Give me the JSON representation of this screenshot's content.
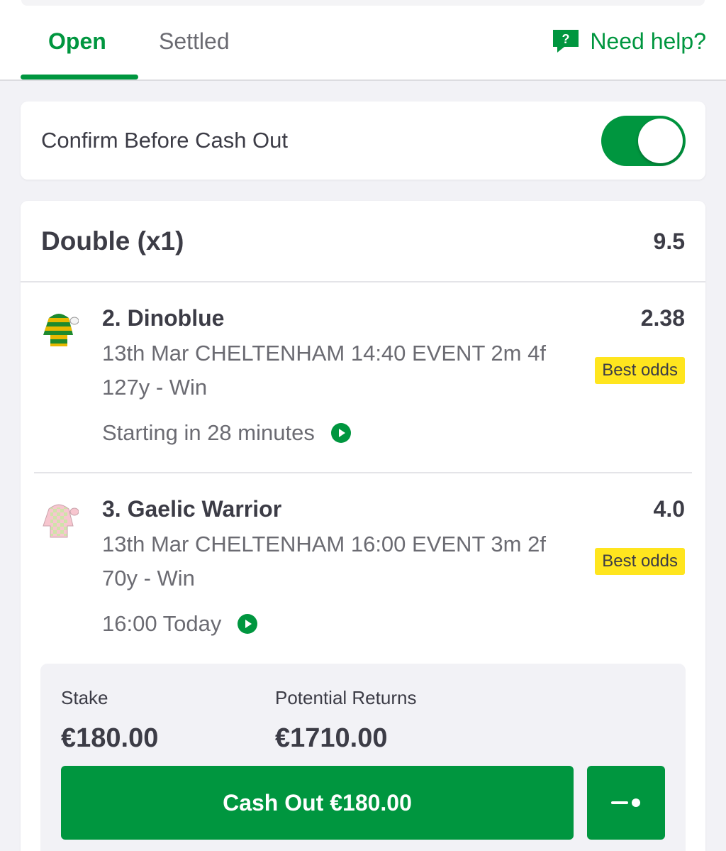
{
  "tabs": {
    "open": "Open",
    "settled": "Settled",
    "active": "open"
  },
  "help": {
    "label": "Need help?",
    "icon": "question-chat-icon"
  },
  "confirm_cash_out": {
    "label": "Confirm Before Cash Out",
    "enabled": true
  },
  "bet": {
    "type": "Double (x1)",
    "odds": "9.5",
    "selections": [
      {
        "name": "2. Dinoblue",
        "description": "13th Mar CHELTENHAM 14:40 EVENT 2m 4f 127y - Win",
        "price": "2.38",
        "badge": "Best odds",
        "status": "Starting in 28 minutes",
        "silks_icon": "green-gold-hoops-silks-icon"
      },
      {
        "name": "3. Gaelic Warrior",
        "description": "13th Mar CHELTENHAM 16:00 EVENT 3m 2f 70y - Win",
        "price": "4.0",
        "badge": "Best odds",
        "status": "16:00 Today",
        "silks_icon": "pink-green-check-silks-icon"
      }
    ],
    "summary": {
      "stake_label": "Stake",
      "stake_value": "€180.00",
      "returns_label": "Potential Returns",
      "returns_value": "€1710.00"
    },
    "cash_out_label": "Cash Out €180.00",
    "partial_icon": "partial-cash-out-slider-icon"
  },
  "colors": {
    "brand_green": "#00963f",
    "badge_yellow": "#ffe51e",
    "text_dark": "#3c3c46",
    "text_muted": "#6b6b72",
    "background": "#f2f2f6"
  }
}
